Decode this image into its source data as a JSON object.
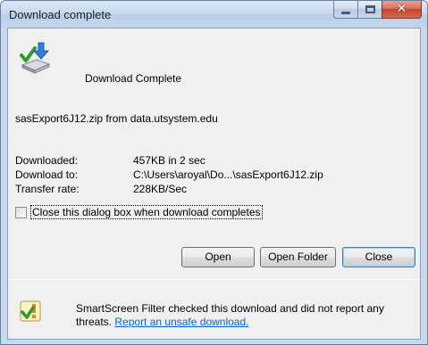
{
  "window": {
    "title": "Download complete",
    "buttons": {
      "close_glyph": "✕"
    }
  },
  "header": {
    "text": "Download Complete",
    "icon": "download-complete-icon"
  },
  "file": {
    "text": "sasExport6J12.zip from data.utsystem.edu"
  },
  "details": [
    {
      "label": "Downloaded:",
      "value": "457KB in 2 sec"
    },
    {
      "label": "Download to:",
      "value": "C:\\Users\\aroyal\\Do...\\sasExport6J12.zip"
    },
    {
      "label": "Transfer rate:",
      "value": "228KB/Sec"
    }
  ],
  "checkbox": {
    "label": "Close this dialog box when download completes",
    "checked": false
  },
  "buttons": {
    "open": "Open",
    "open_folder": "Open Folder",
    "close": "Close"
  },
  "footer": {
    "text": "SmartScreen Filter checked this download and did not report any threats.",
    "link": "Report an unsafe download.",
    "icon": "smartscreen-check-icon"
  },
  "colors": {
    "link": "#0066cc",
    "default_button_border": "#3c7fb1",
    "close_button": "#c4432b"
  }
}
